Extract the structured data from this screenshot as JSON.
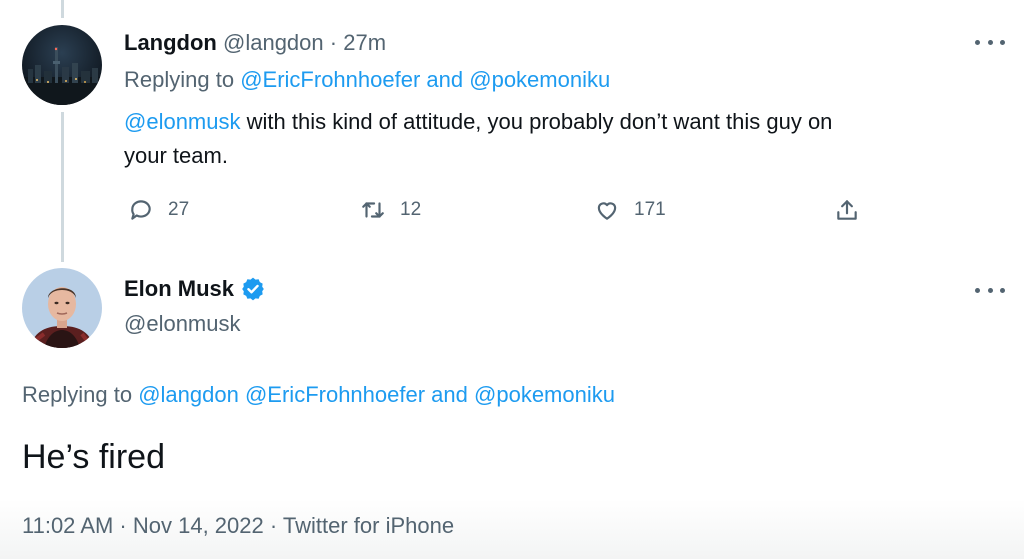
{
  "reply_tweet": {
    "display_name": "Langdon",
    "handle": "@langdon",
    "separator": "·",
    "time": "27m",
    "replying_prefix": "Replying to",
    "replying_user_1": "@EricFrohnhoefer",
    "replying_and": "and",
    "replying_user_2": "@pokemoniku",
    "mention": "@elonmusk",
    "body_line1": "with this kind of attitude, you probably don’t want this guy on",
    "body_line2": "your team.",
    "reply_count": "27",
    "retweet_count": "12",
    "like_count": "171",
    "icons": [
      "reply-icon",
      "retweet-icon",
      "like-icon",
      "share-icon",
      "more-icon"
    ]
  },
  "main_tweet": {
    "display_name": "Elon Musk",
    "handle": "@elonmusk",
    "verified": true,
    "replying_prefix": "Replying to",
    "replying_user_1": "@langdon",
    "replying_user_2": "@EricFrohnhoefer",
    "replying_and": "and",
    "replying_user_3": "@pokemoniku",
    "text": "He’s fired",
    "meta": "11:02 AM · Nov 14, 2022 · Twitter for iPhone"
  },
  "colors": {
    "link": "#1d9bf0",
    "muted": "#536471",
    "text": "#0f1419",
    "thread_line": "#cfd9de"
  }
}
